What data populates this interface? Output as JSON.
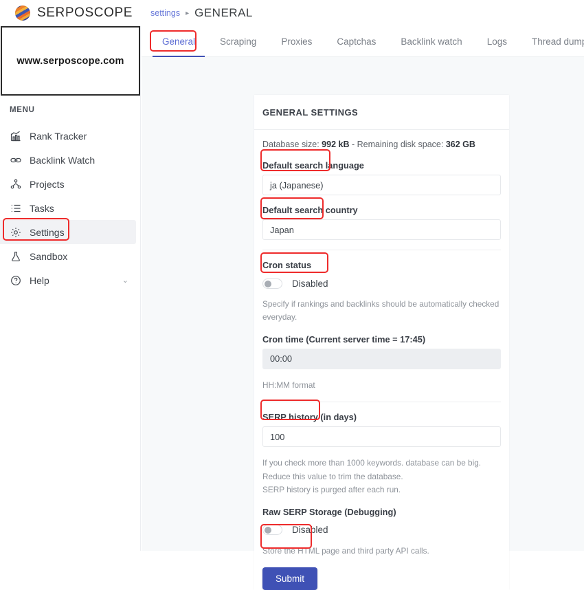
{
  "app": {
    "brand": "SERPOSCOPE",
    "logo_icon": "globe-icon"
  },
  "breadcrumb": {
    "parent": "settings",
    "separator": "▸",
    "current": "GENERAL"
  },
  "sidebar": {
    "site_box_text": "www.serposcope.com",
    "menu_label": "MENU",
    "items": [
      {
        "label": "Rank Tracker",
        "icon": "chart-line-icon",
        "active": false
      },
      {
        "label": "Backlink Watch",
        "icon": "link-icon",
        "active": false
      },
      {
        "label": "Projects",
        "icon": "sitemap-icon",
        "active": false
      },
      {
        "label": "Tasks",
        "icon": "list-icon",
        "active": false
      },
      {
        "label": "Settings",
        "icon": "gear-icon",
        "active": true
      },
      {
        "label": "Sandbox",
        "icon": "flask-icon",
        "active": false
      },
      {
        "label": "Help",
        "icon": "question-circle-icon",
        "active": false,
        "chevron": "⌄"
      }
    ]
  },
  "tabs": [
    {
      "label": "General",
      "active": true
    },
    {
      "label": "Scraping",
      "active": false
    },
    {
      "label": "Proxies",
      "active": false
    },
    {
      "label": "Captchas",
      "active": false
    },
    {
      "label": "Backlink watch",
      "active": false
    },
    {
      "label": "Logs",
      "active": false
    },
    {
      "label": "Thread dump",
      "active": false
    }
  ],
  "settings": {
    "card_title": "GENERAL SETTINGS",
    "database": {
      "size_prefix": "Database size: ",
      "size_value": "992 kB",
      "mid": " - Remaining disk space: ",
      "disk_value": "362 GB"
    },
    "language": {
      "label": "Default search language",
      "value": "ja (Japanese)"
    },
    "country": {
      "label": "Default search country",
      "value": "Japan"
    },
    "cron_status": {
      "label": "Cron status",
      "value": "Disabled",
      "help": "Specify if rankings and backlinks should be automatically checked everyday."
    },
    "cron_time": {
      "label": "Cron time (Current server time = 17:45)",
      "value": "00:00",
      "help": "HH:MM format"
    },
    "serp_history": {
      "label": "SERP history (in days)",
      "value": "100",
      "help_line1": "If you check more than 1000 keywords. database can be big. Reduce this value to trim the database.",
      "help_line2": "SERP history is purged after each run."
    },
    "raw_serp": {
      "label": "Raw SERP Storage (Debugging)",
      "value": "Disabled",
      "help": "Store the HTML page and third party API calls."
    },
    "submit_label": "Submit"
  },
  "colors": {
    "accent": "#3f51b5",
    "link": "#6778d9",
    "annotation": "#ee2b2b",
    "sidebar_active_bg": "#f1f2f5"
  }
}
